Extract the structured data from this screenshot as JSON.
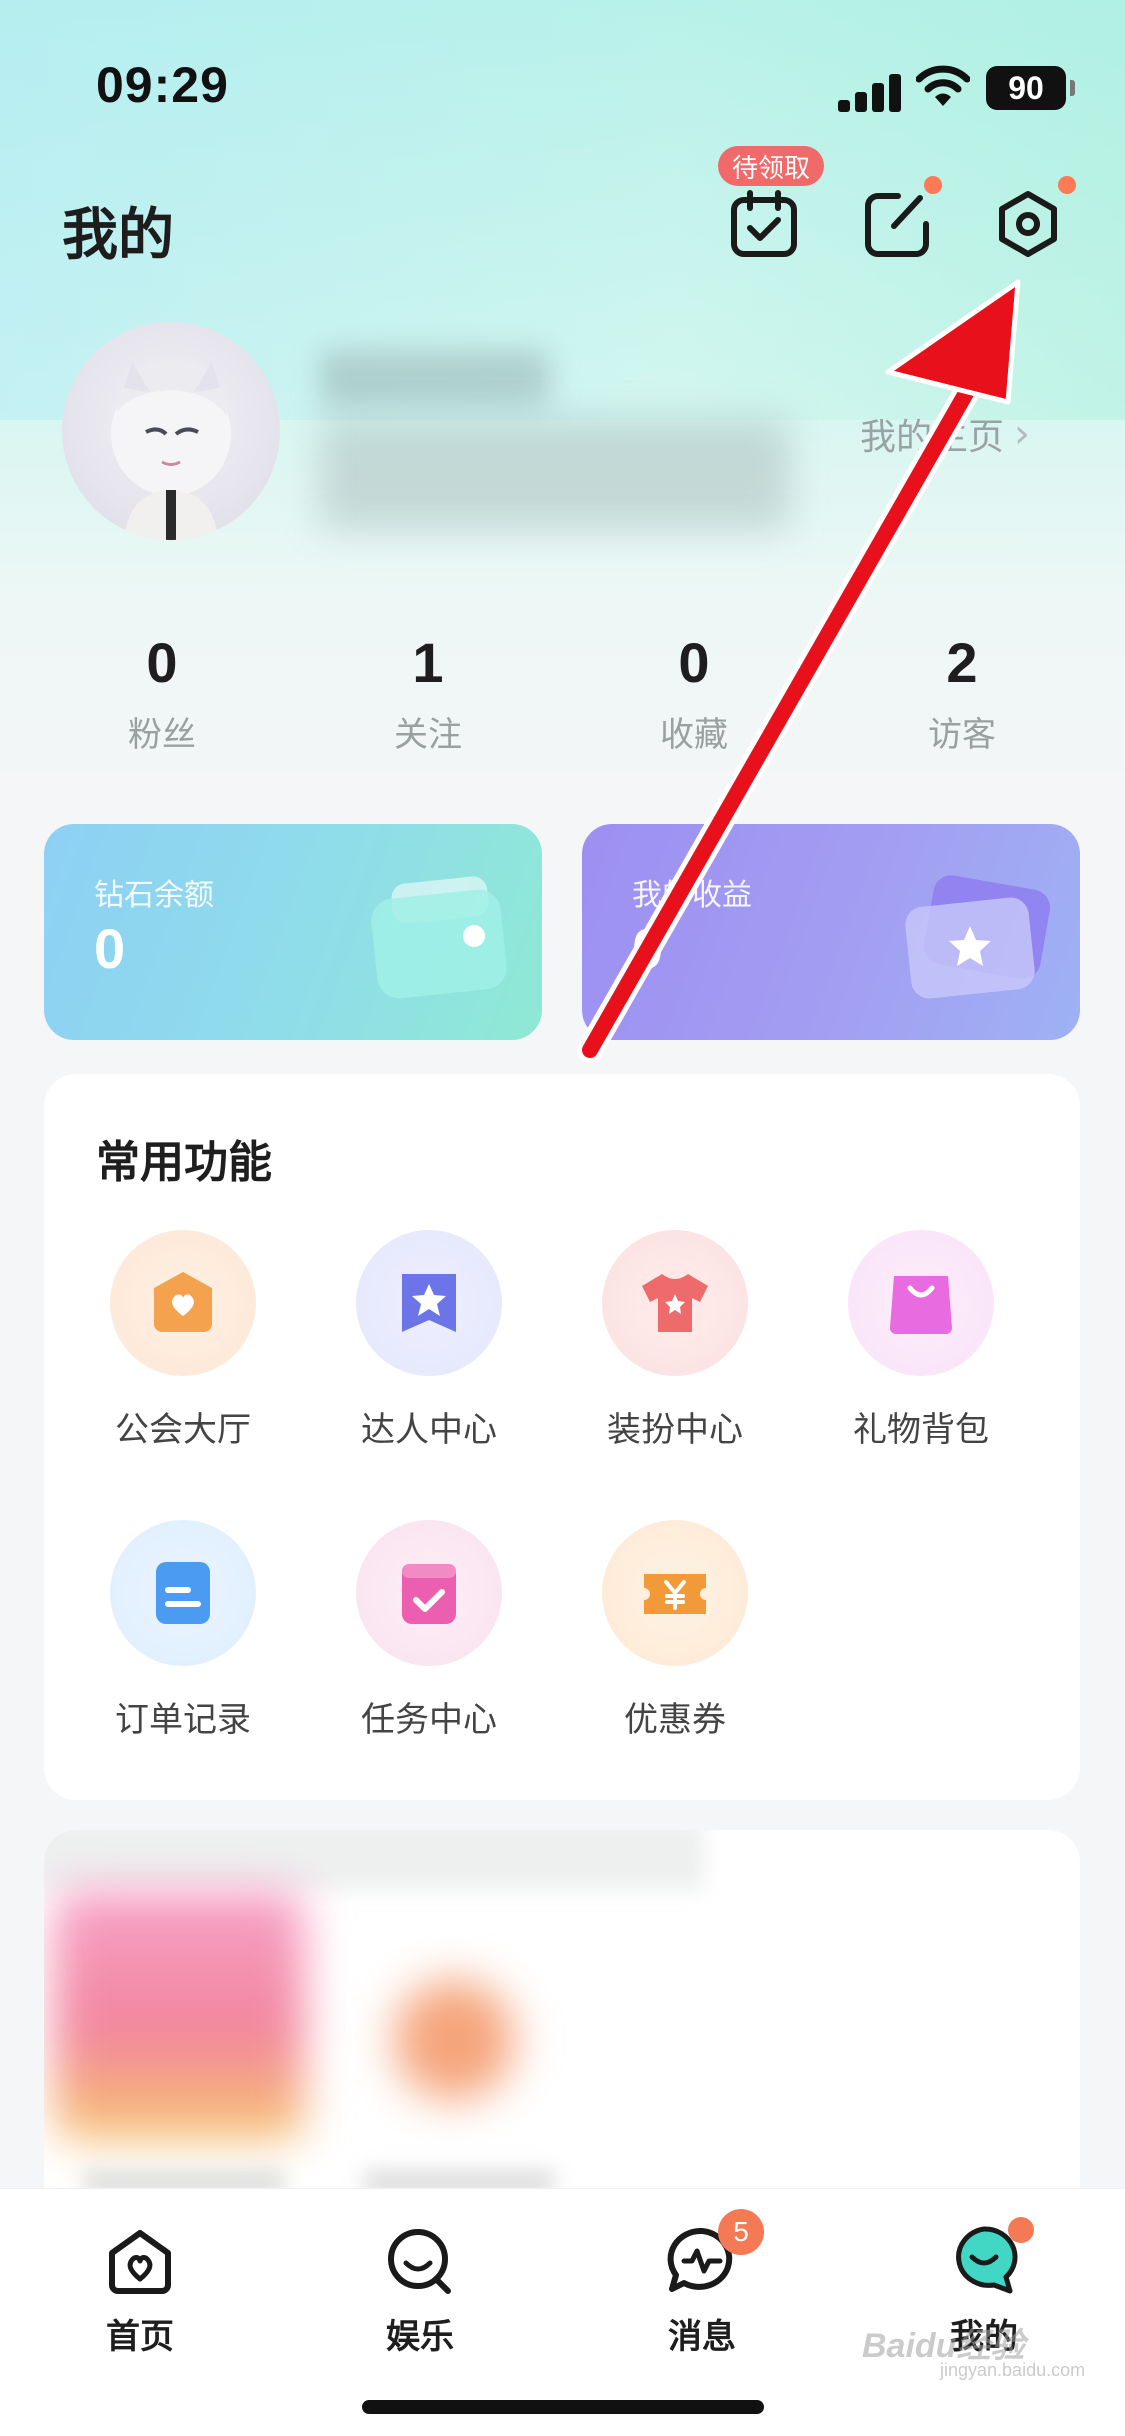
{
  "status_bar": {
    "time": "09:29",
    "battery": "90"
  },
  "header": {
    "title": "我的",
    "pending_badge": "待领取",
    "icons": [
      "calendar-check-icon",
      "edit-icon",
      "settings-icon"
    ]
  },
  "profile": {
    "homepage_link": "我的主页",
    "chevron": "›"
  },
  "stats": [
    {
      "value": "0",
      "label": "粉丝"
    },
    {
      "value": "1",
      "label": "关注"
    },
    {
      "value": "0",
      "label": "收藏"
    },
    {
      "value": "2",
      "label": "访客"
    }
  ],
  "cards": {
    "wallet": {
      "label": "钻石余额",
      "value": "0"
    },
    "income": {
      "label": "我的收益",
      "value": "0"
    }
  },
  "functions": {
    "title": "常用功能",
    "items": [
      {
        "label": "公会大厅",
        "icon": "guild-heart-icon"
      },
      {
        "label": "达人中心",
        "icon": "star-ribbon-icon"
      },
      {
        "label": "装扮中心",
        "icon": "shirt-icon"
      },
      {
        "label": "礼物背包",
        "icon": "gift-bag-icon"
      },
      {
        "label": "订单记录",
        "icon": "order-list-icon"
      },
      {
        "label": "任务中心",
        "icon": "task-check-icon"
      },
      {
        "label": "优惠券",
        "icon": "coupon-yen-icon"
      }
    ]
  },
  "tabbar": {
    "items": [
      {
        "label": "首页",
        "icon": "home-heart-icon"
      },
      {
        "label": "娱乐",
        "icon": "entertainment-icon"
      },
      {
        "label": "消息",
        "icon": "message-icon",
        "badge": "5"
      },
      {
        "label": "我的",
        "icon": "me-face-icon"
      }
    ]
  },
  "watermark": {
    "text": "Baidu经验",
    "sub": "jingyan.baidu.com"
  },
  "colors": {
    "accent_red": "#f06a6a",
    "dot_orange": "#ff7a55",
    "arrow_red": "#e8101a",
    "tab_active": "#42d6c4"
  }
}
